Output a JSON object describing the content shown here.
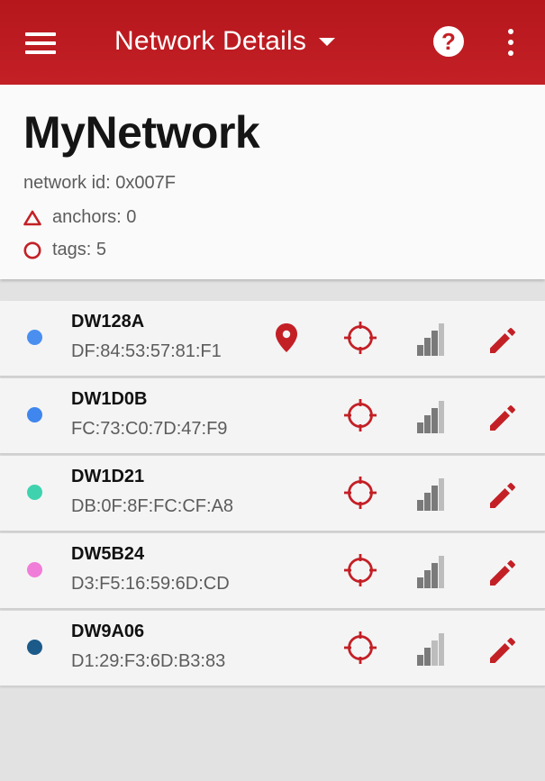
{
  "appbar": {
    "title": "Network Details",
    "menu_icon": "hamburger-menu-icon",
    "dropdown_icon": "caret-down-icon",
    "help_icon": "help-circle-icon",
    "help_glyph": "?",
    "more_icon": "more-vertical-icon",
    "color": "#c32026"
  },
  "network": {
    "name": "MyNetwork",
    "network_id": "network id: 0x007F",
    "anchors": "anchors: 0",
    "tags": "tags: 5",
    "anchor_icon": "triangle-outline-icon",
    "tag_icon": "circle-outline-icon"
  },
  "devices": [
    {
      "name": "DW128A",
      "mac": "DF:84:53:57:81:F1",
      "dot_color": "#4a8ff0",
      "has_location_pin": true
    },
    {
      "name": "DW1D0B",
      "mac": "FC:73:C0:7D:47:F9",
      "dot_color": "#3f86ee",
      "has_location_pin": false
    },
    {
      "name": "DW1D21",
      "mac": "DB:0F:8F:FC:CF:A8",
      "dot_color": "#3ed3ae",
      "has_location_pin": false
    },
    {
      "name": "DW5B24",
      "mac": "D3:F5:16:59:6D:CD",
      "dot_color": "#f07ed8",
      "has_location_pin": false
    },
    {
      "name": "DW9A06",
      "mac": "D1:29:F3:6D:B3:83",
      "dot_color": "#1c5a8a",
      "has_location_pin": false
    }
  ],
  "device_row_icons": {
    "location": "location-pin-icon",
    "target": "crosshair-target-icon",
    "signal": "signal-strength-icon",
    "edit": "pencil-edit-icon"
  }
}
